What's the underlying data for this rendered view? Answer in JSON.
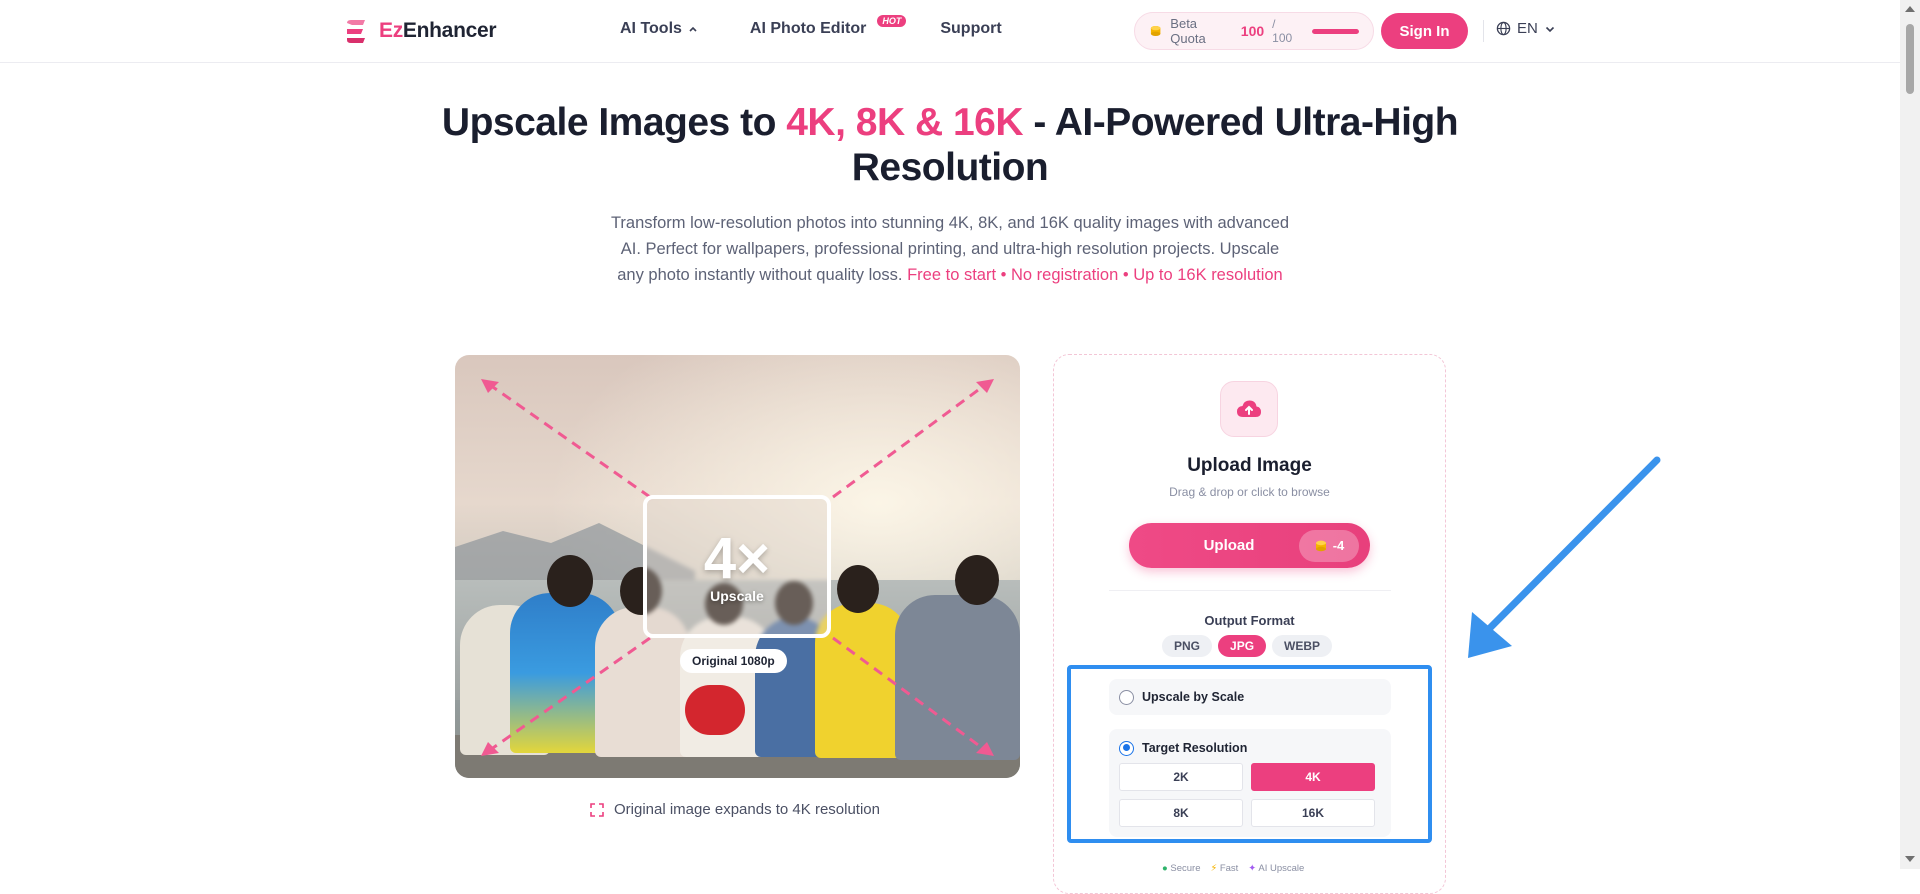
{
  "brand": {
    "prefix": "Ez",
    "suffix": "Enhancer"
  },
  "nav": {
    "links": [
      {
        "label": "AI Tools",
        "has_caret": true
      },
      {
        "label": "AI Photo Editor",
        "badge": "HOT"
      },
      {
        "label": "Support"
      }
    ],
    "quota": {
      "label": "Beta Quota",
      "used": "100",
      "total": "/ 100",
      "fill_percent": 100
    },
    "signin_label": "Sign In",
    "language": "EN"
  },
  "hero": {
    "title_pre": "Upscale Images to ",
    "title_highlight": "4K, 8K & 16K",
    "title_post": " - AI-Powered Ultra-High Resolution",
    "subtitle": "Transform low-resolution photos into stunning 4K, 8K, and 16K quality images with advanced AI. Perfect for wallpapers, professional printing, and ultra-high resolution projects. Upscale any photo instantly without quality loss.",
    "subtitle_highlight": "Free to start • No registration • Up to 16K resolution"
  },
  "demo": {
    "zoom_text": "4×",
    "zoom_caption": "Upscale",
    "original_badge": "Original 1080p",
    "caption": "Original image expands to 4K resolution"
  },
  "upload": {
    "title": "Upload Image",
    "subtitle": "Drag & drop or click to browse",
    "button_label": "Upload",
    "cost": "-4",
    "output_format_label": "Output Format",
    "formats": [
      {
        "label": "PNG",
        "active": false
      },
      {
        "label": "JPG",
        "active": true
      },
      {
        "label": "WEBP",
        "active": false
      }
    ],
    "mode_scale_label": "Upscale by Scale",
    "mode_target_label": "Target Resolution",
    "resolutions": [
      {
        "label": "2K",
        "active": false
      },
      {
        "label": "4K",
        "active": true
      },
      {
        "label": "8K",
        "active": false
      },
      {
        "label": "16K",
        "active": false
      }
    ],
    "tags": [
      "Secure",
      "Fast",
      "AI Upscale"
    ]
  },
  "colors": {
    "accent": "#ec3f7f",
    "annotation": "#2f8ef0",
    "radio": "#1a73e8"
  }
}
